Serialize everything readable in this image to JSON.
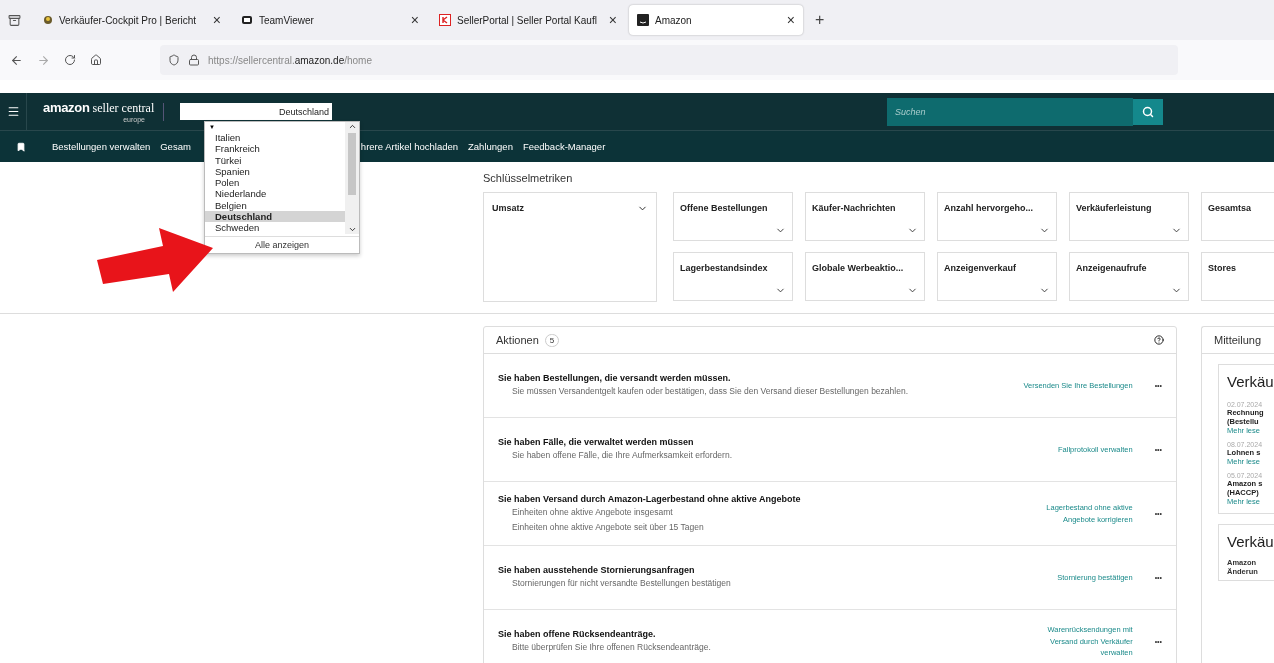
{
  "browser": {
    "tabs": [
      {
        "title": "Verkäufer-Cockpit Pro | Bericht",
        "kind": "leaf",
        "close": "×",
        "selected": false
      },
      {
        "title": "TeamViewer",
        "kind": "screen",
        "close": "×",
        "selected": false
      },
      {
        "title": "SellerPortal | Seller Portal Kaufl",
        "kind": "letter",
        "close": "×",
        "selected": false
      },
      {
        "title": "Amazon",
        "kind": "square",
        "close": "×",
        "selected": true
      }
    ],
    "new_tab": "+",
    "address": {
      "prefix": "https://sellercentral.",
      "domain": "amazon.de",
      "path": "/home"
    }
  },
  "header": {
    "logo": {
      "brand": "amazon",
      "product": "seller central",
      "region": "europe"
    },
    "region_select": "Deutschland",
    "search": {
      "placeholder": "Suchen"
    }
  },
  "nav": {
    "items": [
      "Bestellungen verwalten",
      "Gesam",
      "hrere Artikel hochladen",
      "Zahlungen",
      "Feedback-Manager"
    ]
  },
  "region_dropdown": {
    "caret": "▼",
    "options": [
      {
        "label": "Italien",
        "selected": false
      },
      {
        "label": "Frankreich",
        "selected": false
      },
      {
        "label": "Türkei",
        "selected": false
      },
      {
        "label": "Spanien",
        "selected": false
      },
      {
        "label": "Polen",
        "selected": false
      },
      {
        "label": "Niederlande",
        "selected": false
      },
      {
        "label": "Belgien",
        "selected": false
      },
      {
        "label": "Deutschland",
        "selected": true
      },
      {
        "label": "Schweden",
        "selected": false
      }
    ],
    "show_all": "Alle anzeigen"
  },
  "metrics": {
    "title": "Schlüsselmetriken",
    "main": "Umsatz",
    "cards": [
      [
        "Offene Bestellungen",
        "Käufer-Nachrichten",
        "Anzahl hervorgeho...",
        "Verkäuferleistung",
        "Gesamtsa"
      ],
      [
        "Lagerbestandsindex",
        "Globale Werbeaktio...",
        "Anzeigenverkauf",
        "Anzeigenaufrufe",
        "Stores"
      ]
    ]
  },
  "actions": {
    "title": "Aktionen",
    "count": "5",
    "rows": [
      {
        "title": "Sie haben Bestellungen, die versandt werden müssen.",
        "lines": [
          "Sie müssen Versandentgelt kaufen oder bestätigen, dass Sie den Versand dieser Bestellungen bezahlen."
        ],
        "link": "Versenden Sie Ihre Bestellungen",
        "menu": "•••"
      },
      {
        "title": "Sie haben Fälle, die verwaltet werden müssen",
        "lines": [
          "Sie haben offene Fälle, die Ihre Aufmerksamkeit erfordern."
        ],
        "link": "Fallprotokoll verwalten",
        "menu": "•••"
      },
      {
        "title": "Sie haben Versand durch Amazon-Lagerbestand ohne aktive Angebote",
        "lines": [
          "Einheiten ohne aktive Angebote insgesamt",
          "Einheiten ohne aktive Angebote seit über 15 Tagen"
        ],
        "link": "Lagerbestand ohne aktive Angebote korrigieren",
        "menu": "•••"
      },
      {
        "title": "Sie haben ausstehende Stornierungsanfragen",
        "lines": [
          "Stornierungen für nicht versandte Bestellungen bestätigen"
        ],
        "link": "Stornierung bestätigen",
        "menu": "•••"
      },
      {
        "title": "Sie haben offene Rücksendeanträge.",
        "lines": [
          "Bitte überprüfen Sie Ihre offenen Rücksendeanträge."
        ],
        "link": "Warenrücksendungen mit Versand durch Verkäufer verwalten",
        "menu": "•••"
      }
    ]
  },
  "notices": {
    "title": "Mitteilung",
    "cards": [
      {
        "heading": "Verkäu",
        "items": [
          {
            "date": "02.07.2024",
            "title": [
              "Rechnung",
              "(Bestellu"
            ],
            "more": "Mehr lese"
          },
          {
            "date": "08.07.2024",
            "title": [
              "Lohnen s"
            ],
            "more": "Mehr lese"
          },
          {
            "date": "05.07.2024",
            "title": [
              "Amazon s",
              "(HACCP)"
            ],
            "more": "Mehr lese"
          }
        ]
      },
      {
        "heading": "Verkäu",
        "lines": [
          "Amazon",
          "Änderun"
        ]
      }
    ]
  }
}
